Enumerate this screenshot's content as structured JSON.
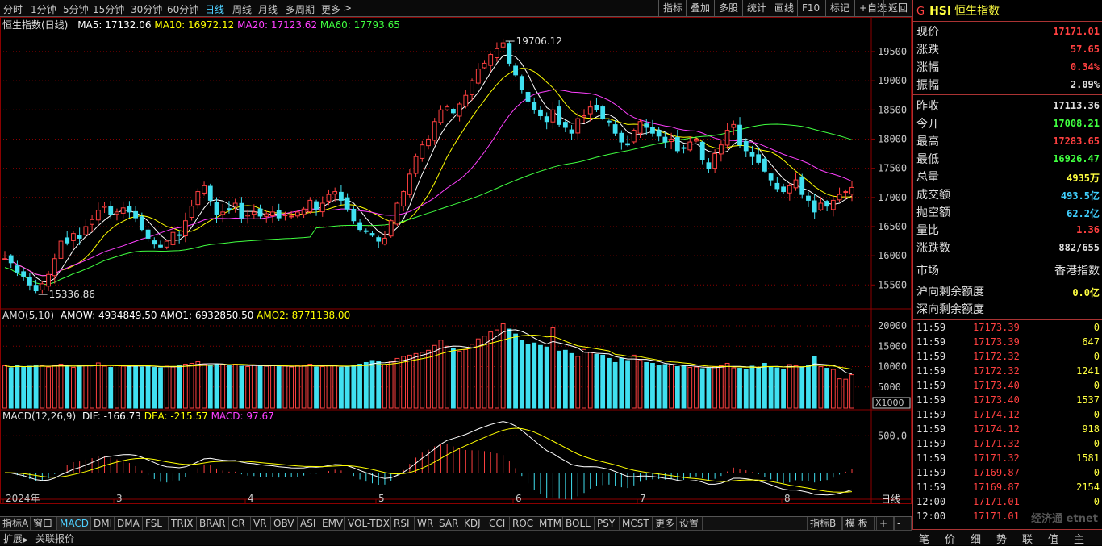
{
  "toolbar": {
    "periods": [
      "分时",
      "1分钟",
      "5分钟",
      "15分钟",
      "30分钟",
      "60分钟",
      "日线",
      "周线",
      "月线",
      "多周期",
      "更多"
    ],
    "active_period": "日线",
    "more_arrow": ">",
    "right_buttons": [
      "指标",
      "叠加",
      "多股",
      "统计",
      "画线",
      "F10",
      "标记",
      "+自选",
      "返回"
    ]
  },
  "main_panel": {
    "title": "恒生指数(日线)",
    "ma5": "MA5: 17132.06",
    "ma10": "MA10: 16972.12",
    "ma20": "MA20: 17123.62",
    "ma60": "MA60: 17793.65",
    "high_label": "19706.12",
    "low_label": "15336.86",
    "y_ticks": [
      "19500",
      "19000",
      "18500",
      "18000",
      "17500",
      "17000",
      "16500",
      "16000",
      "15500"
    ]
  },
  "amo_panel": {
    "title": "AMO(5,10)",
    "amow": "AMOW: 4934849.50",
    "amo1": "AMO1: 6932850.50",
    "amo2": "AMO2: 8771138.00",
    "y_ticks": [
      "20000",
      "15000",
      "10000",
      "5000"
    ],
    "unit": "X1000"
  },
  "macd_panel": {
    "title": "MACD(12,26,9)",
    "dif": "DIF: -166.73",
    "dea": "DEA: -215.57",
    "macd": "MACD: 97.67",
    "y_ticks": [
      "500.0"
    ]
  },
  "x_axis": {
    "labels": [
      "2024年",
      "3",
      "4",
      "5",
      "6",
      "7",
      "8"
    ],
    "period": "日线"
  },
  "bottom_tabs": [
    "指标A",
    "窗口",
    "MACD",
    "DMI",
    "DMA",
    "FSL",
    "TRIX",
    "BRAR",
    "CR",
    "VR",
    "OBV",
    "ASI",
    "EMV",
    "VOL-TDX",
    "RSI",
    "WR",
    "SAR",
    "KDJ",
    "CCI",
    "ROC",
    "MTM",
    "BOLL",
    "PSY",
    "MCST",
    "更多",
    "设置"
  ],
  "bottom_active_tab": "MACD",
  "bottom_right": [
    "指标B",
    "模 板",
    "+",
    "-"
  ],
  "status_bar": {
    "expand": "扩展",
    "expand_arrow": "▶",
    "related": "关联报价"
  },
  "quote": {
    "badge": "G",
    "code": "HSI",
    "name": "恒生指数",
    "rows1": [
      {
        "label": "现价",
        "value": "17171.01",
        "color": "#ff4040"
      },
      {
        "label": "涨跌",
        "value": "57.65",
        "color": "#ff4040"
      },
      {
        "label": "涨幅",
        "value": "0.34%",
        "color": "#ff4040"
      },
      {
        "label": "振幅",
        "value": "2.09%",
        "color": "#e0e0e0"
      }
    ],
    "rows2": [
      {
        "label": "昨收",
        "value": "17113.36",
        "color": "#e0e0e0"
      },
      {
        "label": "今开",
        "value": "17008.21",
        "color": "#40ff40"
      },
      {
        "label": "最高",
        "value": "17283.65",
        "color": "#ff4040"
      },
      {
        "label": "最低",
        "value": "16926.47",
        "color": "#40ff40"
      },
      {
        "label": "总量",
        "value": "4935万",
        "color": "#ffff40"
      },
      {
        "label": "成交额",
        "value": "493.5亿",
        "color": "#40d0ff"
      },
      {
        "label": "抛空额",
        "value": "62.2亿",
        "color": "#40d0ff"
      },
      {
        "label": "量比",
        "value": "1.36",
        "color": "#ff4040"
      },
      {
        "label": "涨跌数",
        "value": "882/655",
        "color": "#e0e0e0"
      }
    ],
    "market_label": "市场",
    "market_value": "香港指数",
    "north1_label": "沪向剩余额度",
    "north1_value": "0.0亿",
    "north2_label": "深向剩余额度",
    "north2_value": ""
  },
  "ticks": [
    {
      "time": "11:59",
      "price": "17173.39",
      "vol": "0"
    },
    {
      "time": "11:59",
      "price": "17173.39",
      "vol": "647"
    },
    {
      "time": "11:59",
      "price": "17172.32",
      "vol": "0"
    },
    {
      "time": "11:59",
      "price": "17172.32",
      "vol": "1241"
    },
    {
      "time": "11:59",
      "price": "17173.40",
      "vol": "0"
    },
    {
      "time": "11:59",
      "price": "17173.40",
      "vol": "1537"
    },
    {
      "time": "11:59",
      "price": "17174.12",
      "vol": "0"
    },
    {
      "time": "11:59",
      "price": "17174.12",
      "vol": "918"
    },
    {
      "time": "11:59",
      "price": "17171.32",
      "vol": "0"
    },
    {
      "time": "11:59",
      "price": "17171.32",
      "vol": "1581"
    },
    {
      "time": "11:59",
      "price": "17169.87",
      "vol": "0"
    },
    {
      "time": "11:59",
      "price": "17169.87",
      "vol": "2154"
    },
    {
      "time": "12:00",
      "price": "17171.01",
      "vol": "0"
    },
    {
      "time": "12:00",
      "price": "17171.01",
      "vol": ""
    }
  ],
  "rp_tabs": [
    "笔",
    "价",
    "细",
    "势",
    "联",
    "值",
    "主"
  ],
  "watermark": "经济通 etnet",
  "colors": {
    "up": "#ff4040",
    "down": "#40e0f0",
    "ma5": "#ffffff",
    "ma10": "#ffff00",
    "ma20": "#ff40ff",
    "ma60": "#40ff40",
    "grid": "#8b0000"
  },
  "chart_data": {
    "type": "candlestick",
    "title": "恒生指数(日线)",
    "yrange": [
      15200,
      19900
    ],
    "markers": {
      "high": 19706.12,
      "low": 15336.86
    },
    "closes": [
      15950,
      15880,
      15720,
      15650,
      15500,
      15400,
      15520,
      15680,
      15950,
      16250,
      16220,
      16380,
      16300,
      16500,
      16620,
      16780,
      16850,
      16700,
      16750,
      16820,
      16750,
      16650,
      16450,
      16300,
      16200,
      16150,
      16250,
      16400,
      16350,
      16600,
      16850,
      17100,
      17200,
      16950,
      16700,
      16750,
      16800,
      16900,
      16650,
      16700,
      16750,
      16680,
      16720,
      16750,
      16650,
      16700,
      16680,
      16750,
      16800,
      16950,
      16800,
      16900,
      17050,
      17100,
      16950,
      16800,
      16600,
      16450,
      16420,
      16350,
      16250,
      16300,
      16600,
      16900,
      17100,
      17400,
      17700,
      17900,
      18000,
      18300,
      18500,
      18550,
      18450,
      18600,
      18750,
      19000,
      19200,
      19300,
      19450,
      19550,
      19650,
      19300,
      19100,
      18850,
      18650,
      18500,
      18400,
      18300,
      18500,
      18250,
      18200,
      18100,
      18350,
      18400,
      18550,
      18500,
      18350,
      18300,
      18100,
      17950,
      17900,
      18150,
      18300,
      18200,
      18100,
      18050,
      17950,
      18000,
      17800,
      17850,
      17950,
      18000,
      17650,
      17500,
      17750,
      17900,
      18150,
      18250,
      17900,
      17800,
      17700,
      17600,
      17450,
      17300,
      17150,
      17100,
      17200,
      17300,
      17050,
      16950,
      16750,
      16900,
      16850,
      16950,
      17050,
      17100,
      17171
    ],
    "amo": [
      10200,
      9700,
      10300,
      9800,
      10100,
      10400,
      10200,
      9900,
      10300,
      10600,
      10000,
      9800,
      10200,
      10400,
      10300,
      10900,
      10100,
      9800,
      10200,
      10100,
      10300,
      10200,
      9900,
      10200,
      9800,
      9700,
      10100,
      9900,
      10200,
      10600,
      10800,
      11200,
      10600,
      10300,
      10600,
      10500,
      10200,
      10600,
      10100,
      10000,
      10400,
      10200,
      10100,
      10300,
      10000,
      10100,
      9900,
      10200,
      10300,
      10600,
      9900,
      10000,
      10200,
      10400,
      9800,
      10000,
      10300,
      10600,
      11000,
      11500,
      11200,
      10500,
      11300,
      12000,
      12500,
      12800,
      13200,
      13500,
      14000,
      15200,
      16500,
      15000,
      14500,
      13800,
      14200,
      15500,
      16800,
      17500,
      18500,
      19000,
      20500,
      19200,
      18000,
      16500,
      15500,
      15800,
      15200,
      14800,
      19500,
      13800,
      14000,
      13200,
      12500,
      14200,
      13500,
      13000,
      12800,
      12000,
      11000,
      12000,
      11500,
      12800,
      11500,
      11000,
      10800,
      10200,
      10500,
      10500,
      10000,
      10200,
      9800,
      9900,
      9500,
      9600,
      10000,
      10200,
      10800,
      9700,
      9600,
      9400,
      10100,
      9800,
      10800,
      9900,
      9700,
      9400,
      10500,
      10200,
      9800,
      10400,
      12500,
      10000,
      9600,
      9300,
      7000,
      6900,
      8000
    ]
  }
}
